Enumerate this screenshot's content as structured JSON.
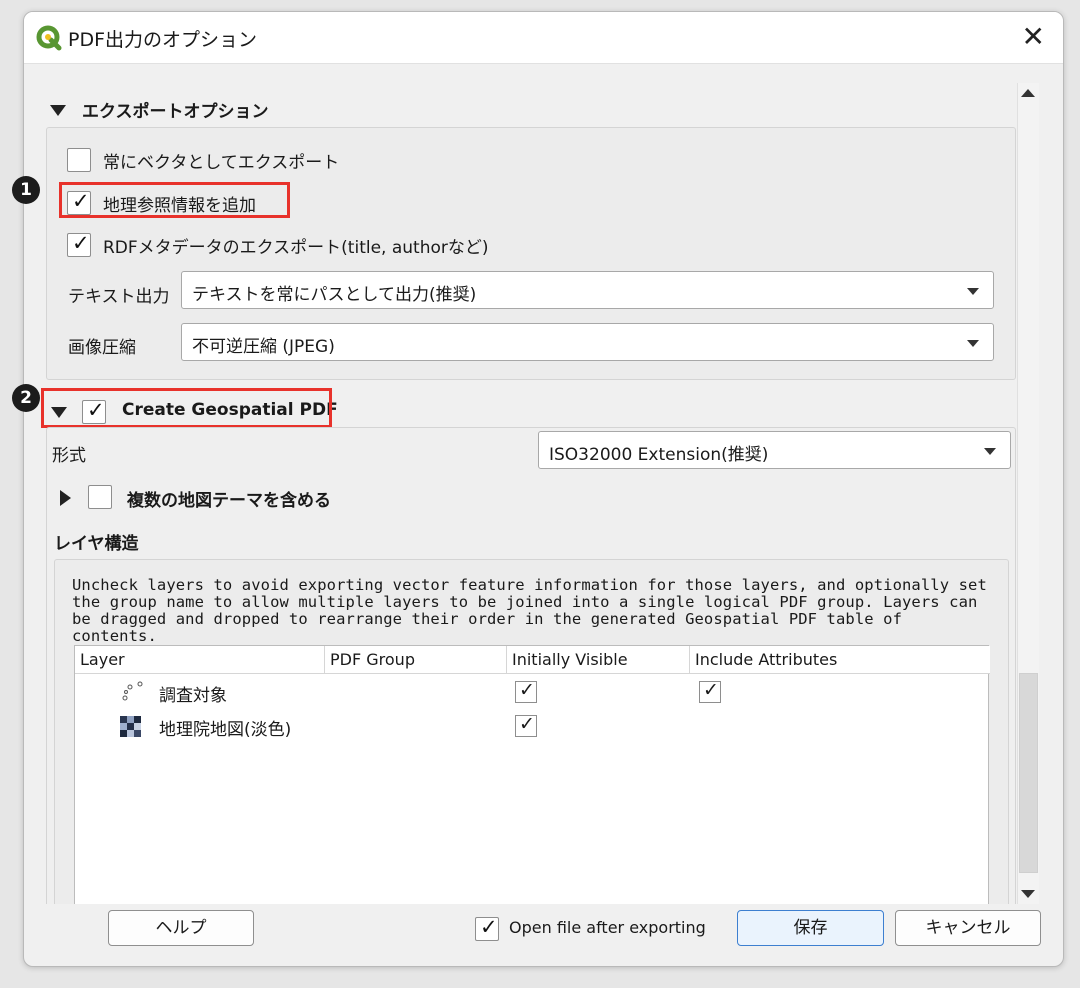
{
  "window": {
    "title": "PDF出力のオプション",
    "close_glyph": "✕"
  },
  "export_options": {
    "header": "エクスポートオプション",
    "always_vector_label": "常にベクタとしてエクスポート",
    "always_vector_checked": false,
    "georef_label": "地理参照情報を追加",
    "georef_checked": true,
    "rdf_label": "RDFメタデータのエクスポート(title, authorなど)",
    "rdf_checked": true,
    "text_output_label": "テキスト出力",
    "text_output_value": "テキストを常にパスとして出力(推奨)",
    "image_compression_label": "画像圧縮",
    "image_compression_value": "不可逆圧縮 (JPEG)"
  },
  "badges": {
    "one": "1",
    "two": "2"
  },
  "geospatial": {
    "header": "Create Geospatial PDF",
    "checked": true,
    "format_label": "形式",
    "format_value": "ISO32000 Extension(推奨)",
    "map_themes_label": "複数の地図テーマを含める",
    "map_themes_checked": false,
    "layer_structure_label": "レイヤ構造",
    "description": "Uncheck layers to avoid exporting vector feature information for those layers, and optionally set the group name to allow multiple layers to be joined into a single logical PDF group. Layers can be dragged and dropped to rearrange their order in the generated Geospatial PDF table of contents."
  },
  "layer_table": {
    "columns": [
      "Layer",
      "PDF Group",
      "Initially Visible",
      "Include Attributes"
    ],
    "rows": [
      {
        "name": "調査対象",
        "icon": "point-layer-icon",
        "initially_visible": true,
        "include_attributes": true
      },
      {
        "name": "地理院地図(淡色)",
        "icon": "raster-layer-icon",
        "initially_visible": true,
        "include_attributes": false
      }
    ]
  },
  "footer": {
    "help_label": "ヘルプ",
    "open_after_label": "Open file after exporting",
    "open_after_checked": true,
    "save_label": "保存",
    "cancel_label": "キャンセル"
  },
  "colors": {
    "highlight": "#e8322b",
    "primary_button_border": "#3d7fd0",
    "qgis_green": "#589632",
    "qgis_yellow": "#f0c020"
  }
}
